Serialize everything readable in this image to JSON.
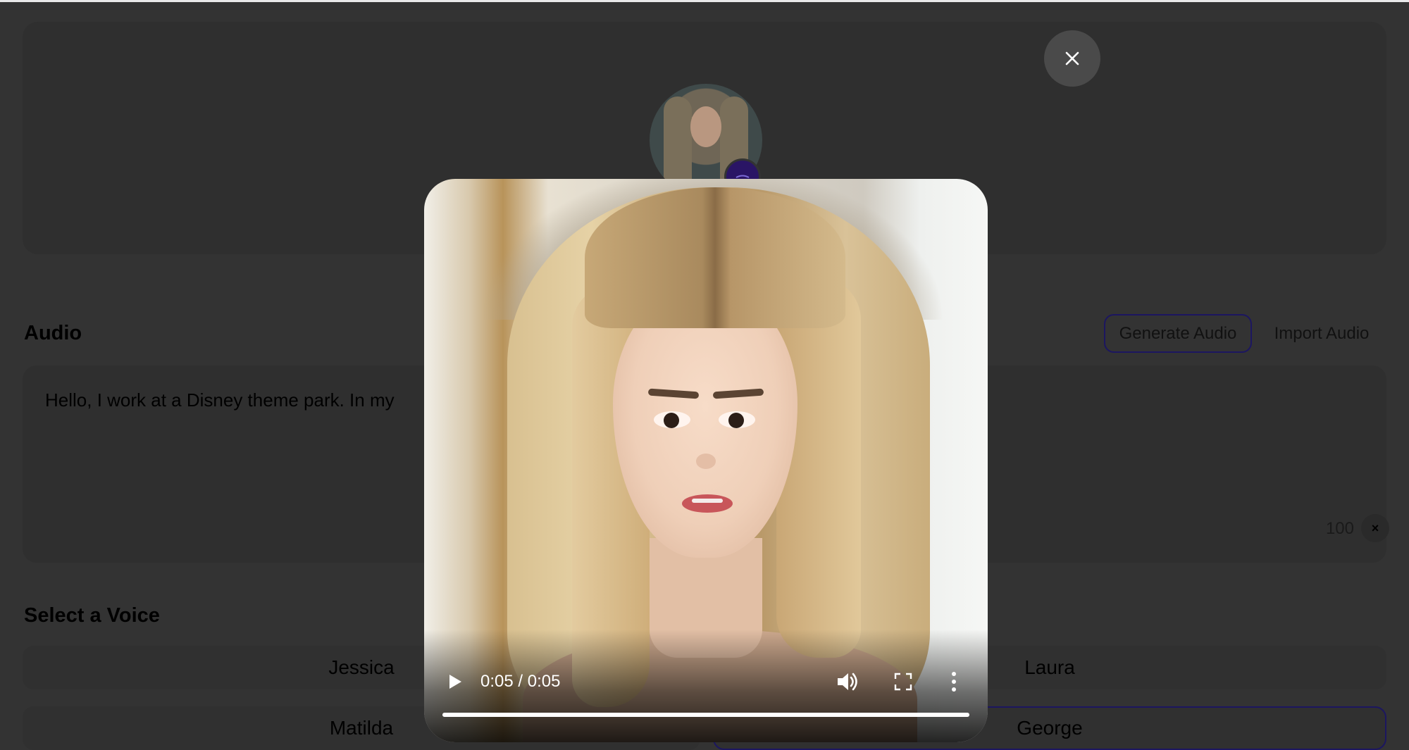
{
  "audio": {
    "title": "Audio",
    "generate_label": "Generate Audio",
    "import_label": "Import Audio",
    "text": "Hello, I work at a Disney theme park. In my",
    "char_count": "100",
    "clear_label": "×"
  },
  "voices": {
    "title": "Select a Voice",
    "items": [
      {
        "label": "Jessica",
        "selected": false
      },
      {
        "label": "Laura",
        "selected": false
      },
      {
        "label": "Matilda",
        "selected": false
      },
      {
        "label": "George",
        "selected": true
      }
    ]
  },
  "modal": {
    "close_label": "×",
    "video": {
      "time": "0:05 / 0:05",
      "progress": 1.0
    }
  },
  "colors": {
    "overlay_bg": "#333333",
    "selected_border": "#1c1660",
    "badge": "#2a1565"
  },
  "icons": {
    "close": "close-icon",
    "play": "play-icon",
    "volume": "volume-icon",
    "fullscreen": "fullscreen-icon",
    "more": "more-vertical-icon",
    "edit_badge": "edit-icon"
  }
}
